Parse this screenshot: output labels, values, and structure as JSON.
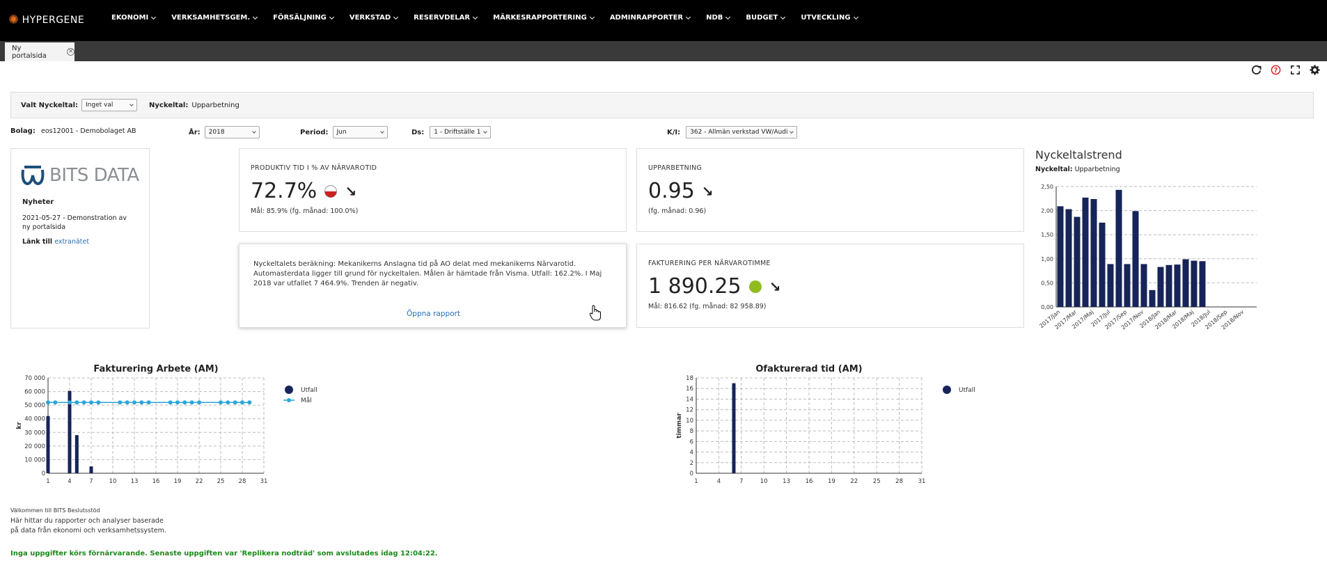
{
  "app": {
    "logo_text": "HYPERGENE"
  },
  "nav": [
    "EKONOMI",
    "VERKSAMHETSGEM.",
    "FÖRSÄLJNING",
    "VERKSTAD",
    "RESERVDELAR",
    "MÄRKESRAPPORTERING",
    "ADMINRAPPORTER",
    "NDB",
    "BUDGET",
    "UTVECKLING"
  ],
  "tab": {
    "label": "Ny portalsida",
    "close": "×"
  },
  "filter": {
    "valt_label": "Valt Nyckeltal:",
    "valt_value": "Inget val",
    "nyckeltal_label": "Nyckeltal:",
    "nyckeltal_value": "Upparbetning"
  },
  "params": {
    "bolag_label": "Bolag:",
    "bolag_value": "eos12001 - Demobolaget AB",
    "ar_label": "År:",
    "ar_value": "2018",
    "period_label": "Period:",
    "period_value": "Jun",
    "ds_label": "Ds:",
    "ds_value": "1 - Driftställe 1",
    "ki_label": "K/I:",
    "ki_value": "362 - Allmän verkstad VW/Audi"
  },
  "news": {
    "logo_text": "BITS DATA",
    "heading": "Nyheter",
    "item": "2021-05-27 - Demonstration av ny portalsida",
    "link_prefix": "Länk till",
    "link_text": "extranätet"
  },
  "kpi1": {
    "title": "PRODUKTIV TID I % AV NÄRVAROTID",
    "value": "72.7%",
    "sub": "Mål: 85.9% (fg. månad: 100.0%)",
    "status_color": "#cc2222"
  },
  "kpi2": {
    "title": "UPPARBETNING",
    "value": "0.95",
    "sub": "(fg. månad: 0.96)"
  },
  "kpi3": {
    "title": "FAKTURERING PER NÄRVAROTIMME",
    "value": "1 890.25",
    "sub": "Mål: 816.62 (fg. månad: 82 958.89)",
    "status_color": "#8fbc1f"
  },
  "info": {
    "text": "Nyckeltalets beräkning: Mekanikerns Anslagna tid på AO delat med mekanikerns Närvarotid. Automasterdata ligger till grund för nyckeltalen. Målen är hämtade från Visma. Utfall: 162.2%. I Maj 2018 var utfallet 7 464.9%. Trenden är negativ.",
    "link": "Öppna rapport"
  },
  "trend": {
    "title": "Nyckeltalstrend",
    "sub_label": "Nyckeltal:",
    "sub_value": "Upparbetning"
  },
  "footer": {
    "welcome_title": "Välkommen till BITS Beslutsstöd",
    "welcome_text": "Här hittar du rapporter och analyser baserade på data från ekonomi och verksamhetssystem.",
    "status": "Inga uppgifter körs förnärvarande. Senaste uppgiften var 'Replikera nodträd' som avslutades idag 12:04:22."
  },
  "chart_data": [
    {
      "type": "bar",
      "title": "Nyckeltalstrend",
      "categories": [
        "2017/Jan",
        "2017/Feb",
        "2017/Mar",
        "2017/Apr",
        "2017/Maj",
        "2017/Jun",
        "2017/Jul",
        "2017/Aug",
        "2017/Sep",
        "2017/Okt",
        "2017/Nov",
        "2017/Dec",
        "2018/Jan",
        "2018/Feb",
        "2018/Mar",
        "2018/Apr",
        "2018/Maj",
        "2018/Jun",
        "2018/Jul",
        "2018/Aug",
        "2018/Sep",
        "2018/Okt",
        "2018/Nov",
        "2018/Dec"
      ],
      "tick_labels": [
        "2017/Jan",
        "2017/Mar",
        "2017/Maj",
        "2017/Jul",
        "2017/Sep",
        "2017/Nov",
        "2018/Jan",
        "2018/Mar",
        "2018/Maj",
        "2018/Jul",
        "2018/Sep",
        "2018/Nov"
      ],
      "values": [
        2.09,
        2.03,
        1.87,
        2.27,
        2.24,
        1.75,
        0.89,
        2.43,
        0.89,
        1.99,
        0.89,
        0.35,
        0.83,
        0.87,
        0.88,
        0.99,
        0.96,
        0.95,
        null,
        null,
        null,
        null,
        null,
        null
      ],
      "ylim": [
        0,
        2.5
      ],
      "yticks": [
        "0,00",
        "0,50",
        "1,00",
        "1,50",
        "2,00",
        "2,50"
      ],
      "color": "#162459"
    },
    {
      "type": "bar+line",
      "title": "Fakturering Arbete (AM)",
      "ylabel": "kr",
      "xlim": [
        1,
        31
      ],
      "xticks": [
        1,
        4,
        7,
        10,
        13,
        16,
        19,
        22,
        25,
        28,
        31
      ],
      "ylim": [
        0,
        70000
      ],
      "yticks": [
        "0",
        "10 000",
        "20 000",
        "30 000",
        "40 000",
        "50 000",
        "60 000",
        "70 000"
      ],
      "series": [
        {
          "name": "Utfall",
          "type": "bar",
          "color": "#162459",
          "x": [
            1,
            4,
            5,
            7
          ],
          "values": [
            42000,
            60500,
            28000,
            5000
          ]
        },
        {
          "name": "Mål",
          "type": "line",
          "color": "#2ba6d9",
          "x": [
            1,
            2,
            4,
            5,
            6,
            7,
            8,
            11,
            12,
            13,
            14,
            15,
            18,
            19,
            20,
            21,
            22,
            25,
            26,
            27,
            28,
            29
          ],
          "values": [
            52000,
            52000,
            52000,
            52000,
            52000,
            52000,
            52000,
            52000,
            52000,
            52000,
            52000,
            52000,
            52000,
            52000,
            52000,
            52000,
            52000,
            52000,
            52000,
            52000,
            52000,
            52000
          ]
        }
      ]
    },
    {
      "type": "bar",
      "title": "Ofakturerad tid (AM)",
      "ylabel": "timmar",
      "xlim": [
        1,
        31
      ],
      "xticks": [
        1,
        4,
        7,
        10,
        13,
        16,
        19,
        22,
        25,
        28,
        31
      ],
      "ylim": [
        0,
        18
      ],
      "yticks": [
        "0",
        "2",
        "4",
        "6",
        "8",
        "10",
        "12",
        "14",
        "16",
        "18"
      ],
      "series": [
        {
          "name": "Utfall",
          "type": "bar",
          "color": "#162459",
          "x": [
            6
          ],
          "values": [
            17
          ]
        }
      ]
    }
  ]
}
